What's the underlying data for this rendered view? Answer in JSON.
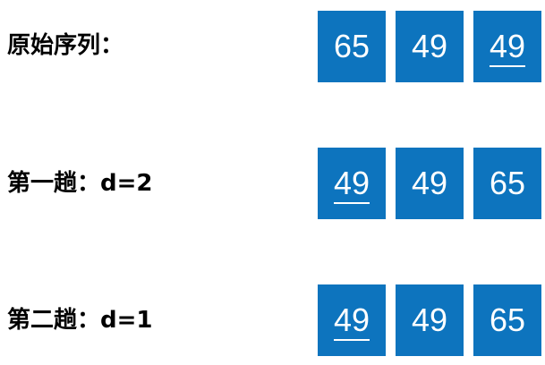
{
  "colors": {
    "cell_fill": "#0d74be",
    "cell_text": "#ffffff",
    "label_text": "#000000"
  },
  "rows": [
    {
      "label": "原始序列：",
      "cells": [
        {
          "value": "65",
          "underlined": false
        },
        {
          "value": "49",
          "underlined": false
        },
        {
          "value": "49",
          "underlined": true
        }
      ]
    },
    {
      "label": "第一趟：d=2",
      "cells": [
        {
          "value": "49",
          "underlined": true
        },
        {
          "value": "49",
          "underlined": false
        },
        {
          "value": "65",
          "underlined": false
        }
      ]
    },
    {
      "label": "第二趟：d=1",
      "cells": [
        {
          "value": "49",
          "underlined": true
        },
        {
          "value": "49",
          "underlined": false
        },
        {
          "value": "65",
          "underlined": false
        }
      ]
    }
  ]
}
